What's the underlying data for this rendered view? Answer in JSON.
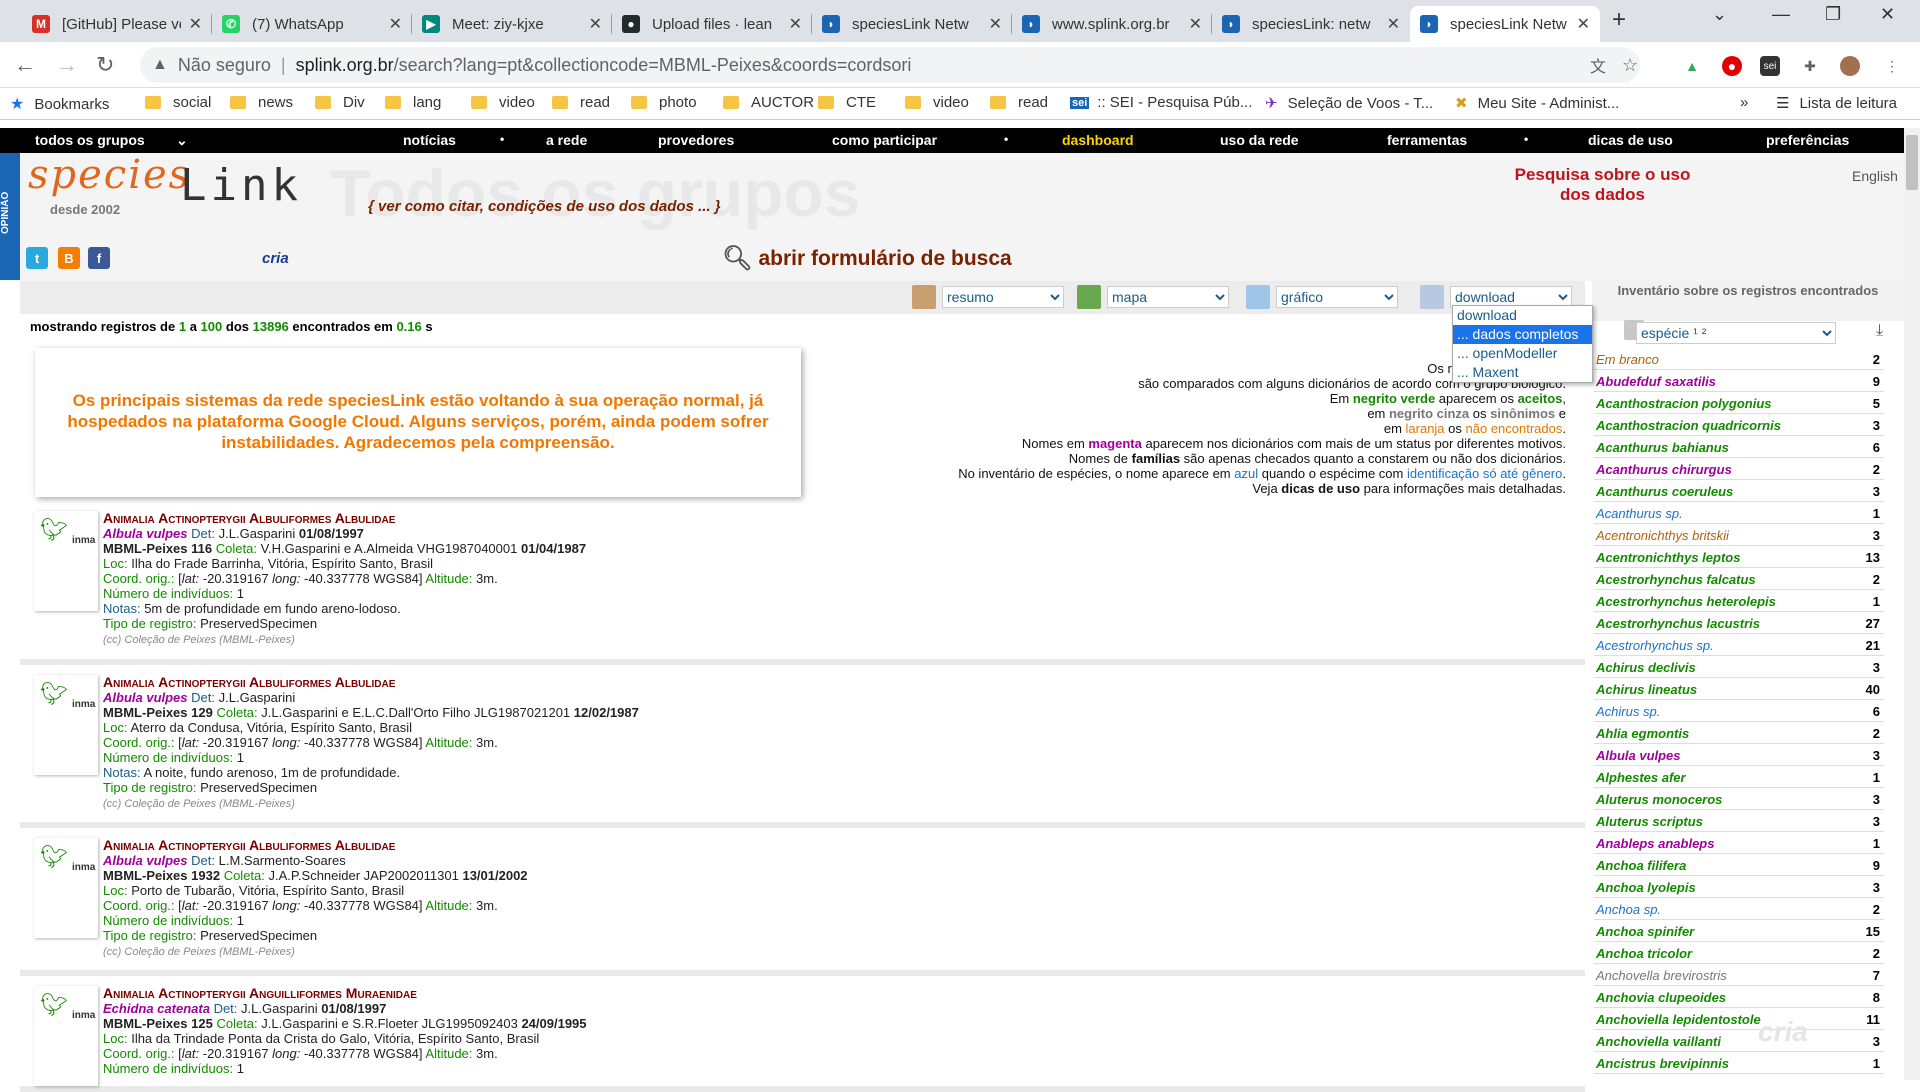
{
  "browser": {
    "tabs": [
      {
        "title": "[GitHub] Please ve",
        "favicon": "gmail-icon",
        "color": "#d93025",
        "glyph": "M"
      },
      {
        "title": "(7) WhatsApp",
        "favicon": "whatsapp-icon",
        "color": "#25d366",
        "glyph": "✆"
      },
      {
        "title": "Meet: ziy-kjxe",
        "favicon": "meet-icon",
        "color": "#00897b",
        "glyph": "▶"
      },
      {
        "title": "Upload files · lean",
        "favicon": "github-icon",
        "color": "#24292e",
        "glyph": "●"
      },
      {
        "title": "speciesLink Netw",
        "favicon": "specieslink-icon",
        "color": "#1a66b5",
        "glyph": "◗"
      },
      {
        "title": "www.splink.org.br",
        "favicon": "specieslink-icon",
        "color": "#1a66b5",
        "glyph": "◗"
      },
      {
        "title": "speciesLink: netw",
        "favicon": "specieslink-icon",
        "color": "#1a66b5",
        "glyph": "◗"
      },
      {
        "title": "speciesLink Netw",
        "favicon": "specieslink-icon",
        "color": "#1a66b5",
        "glyph": "◗"
      }
    ],
    "active_tab": 7,
    "new_tab": "+",
    "address": {
      "security": "Não seguro",
      "host": "splink.org.br",
      "path": "/search?lang=pt&collectioncode=MBML-Peixes&coords=cordsori"
    },
    "bookmarks": [
      {
        "label": "Bookmarks",
        "icon": "star-icon"
      },
      {
        "label": "social",
        "icon": "folder-icon"
      },
      {
        "label": "news",
        "icon": "folder-icon"
      },
      {
        "label": "Div",
        "icon": "folder-icon"
      },
      {
        "label": "lang",
        "icon": "folder-icon"
      },
      {
        "label": "video",
        "icon": "folder-icon"
      },
      {
        "label": "read",
        "icon": "folder-icon"
      },
      {
        "label": "photo",
        "icon": "folder-icon"
      },
      {
        "label": "AUCTOR",
        "icon": "folder-icon"
      },
      {
        "label": "CTE",
        "icon": "folder-icon"
      },
      {
        "label": "video",
        "icon": "folder-icon"
      },
      {
        "label": "read",
        "icon": "folder-icon"
      },
      {
        "label": ":: SEI - Pesquisa Púb...",
        "icon": "sei-icon"
      },
      {
        "label": "Seleção de Voos - T...",
        "icon": "flight-icon"
      },
      {
        "label": "Meu Site - Administ...",
        "icon": "site-icon"
      }
    ],
    "bookmarks_more": "»",
    "reading_list": "Lista de leitura"
  },
  "site": {
    "nav": [
      "todos os grupos",
      "notícias",
      "•",
      "a rede",
      "provedores",
      "como participar",
      "•",
      "dashboard",
      "uso da rede",
      "ferramentas",
      "•",
      "dicas de uso",
      "preferências"
    ],
    "opiniao": "OPINIÃO",
    "logo_species": "species",
    "logo_link": "Link",
    "desde": "desde 2002",
    "big_title": "Todos os grupos",
    "cite": "{ ver como citar, condições de uso dos dados ... }",
    "search_link": "abrir formulário de busca",
    "pesquisa": "Pesquisa sobre o uso dos dados",
    "english": "English",
    "cria": "cria",
    "social": [
      {
        "glyph": "t",
        "color": "#2aa9e0"
      },
      {
        "glyph": "B",
        "color": "#f57d00"
      },
      {
        "glyph": "f",
        "color": "#3b5998"
      }
    ]
  },
  "tools": {
    "resumo": "resumo",
    "mapa": "mapa",
    "grafico": "gráfico",
    "download": "download",
    "download_options": [
      "download",
      "... dados completos",
      "... openModeller",
      "... Maxent"
    ],
    "download_selected": 1
  },
  "showing": {
    "prefix": "mostrando registros de",
    "from": "1",
    "a": "a",
    "to": "100",
    "dos": "dos",
    "total": "13896",
    "encontrados": "encontrados em",
    "time": "0.16",
    "unit": "s"
  },
  "notice": "Os principais sistemas da rede speciesLink estão voltando à sua operação normal, já hospedados na plataforma Google Cloud. Alguns serviços, porém, ainda podem sofrer instabilidades. Agradecemos pela compreensão.",
  "legend": [
    {
      "parts": [
        [
          "Os nomes das espécies",
          ""
        ]
      ]
    },
    {
      "parts": [
        [
          "são comparados com alguns dicionários de acordo com o grupo biológico.",
          ""
        ]
      ]
    },
    {
      "parts": [
        [
          "Em ",
          ""
        ],
        [
          "negrito verde",
          "g"
        ],
        [
          " aparecem os ",
          ""
        ],
        [
          "aceitos",
          "g"
        ],
        [
          ",",
          ""
        ]
      ]
    },
    {
      "parts": [
        [
          "em ",
          ""
        ],
        [
          "negrito cinza",
          "c"
        ],
        [
          " os ",
          ""
        ],
        [
          "sinônimos",
          "c"
        ],
        [
          " e",
          ""
        ]
      ]
    },
    {
      "parts": [
        [
          "em ",
          ""
        ],
        [
          "laranja",
          "o"
        ],
        [
          " os ",
          ""
        ],
        [
          "não encontrados",
          "o"
        ],
        [
          ".",
          ""
        ]
      ]
    },
    {
      "parts": [
        [
          "Nomes em ",
          ""
        ],
        [
          "magenta",
          "m"
        ],
        [
          " aparecem nos dicionários com mais de um status por diferentes motivos.",
          ""
        ]
      ]
    },
    {
      "parts": [
        [
          "Nomes de ",
          ""
        ],
        [
          "famílias",
          "bold"
        ],
        [
          " são apenas checados quanto a constarem ou não dos dicionários.",
          ""
        ]
      ]
    },
    {
      "parts": [
        [
          "No inventário de espécies, o nome aparece em ",
          ""
        ],
        [
          "azul",
          "b"
        ],
        [
          " quando o espécime com ",
          ""
        ],
        [
          "identificação só até gênero",
          "b"
        ],
        [
          ".",
          ""
        ]
      ]
    },
    {
      "parts": [
        [
          "Veja ",
          ""
        ],
        [
          "dicas de uso",
          "bold"
        ],
        [
          " para informações mais detalhadas.",
          ""
        ]
      ]
    }
  ],
  "records": [
    {
      "taxonomy": "Animalia Actinopterygii Albuliformes Albulidae",
      "species": "Albula vulpes",
      "det": "J.L.Gasparini",
      "det_date": "01/08/1997",
      "catalog": "MBML-Peixes 116",
      "coleta": "V.H.Gasparini e A.Almeida VHG1987040001",
      "coleta_date": "01/04/1987",
      "loc": "Ilha do Frade Barrinha, Vitória, Espírito Santo, Brasil",
      "lat": "-20.319167",
      "long": "-40.337778 WGS84",
      "alt": "3m.",
      "individuos": "1",
      "notas": "5m de profundidade em fundo areno-lodoso.",
      "tipo": "PreservedSpecimen",
      "cc": "(cc) Coleção de Peixes (MBML-Peixes)"
    },
    {
      "taxonomy": "Animalia Actinopterygii Albuliformes Albulidae",
      "species": "Albula vulpes",
      "det": "J.L.Gasparini",
      "det_date": "",
      "catalog": "MBML-Peixes 129",
      "coleta": "J.L.Gasparini e E.L.C.Dall'Orto Filho JLG1987021201",
      "coleta_date": "12/02/1987",
      "loc": "Aterro da Condusa, Vitória, Espírito Santo, Brasil",
      "lat": "-20.319167",
      "long": "-40.337778 WGS84",
      "alt": "3m.",
      "individuos": "1",
      "notas": "A noite, fundo arenoso, 1m de profundidade.",
      "tipo": "PreservedSpecimen",
      "cc": "(cc) Coleção de Peixes (MBML-Peixes)"
    },
    {
      "taxonomy": "Animalia Actinopterygii Albuliformes Albulidae",
      "species": "Albula vulpes",
      "det": "L.M.Sarmento-Soares",
      "det_date": "",
      "catalog": "MBML-Peixes 1932",
      "coleta": "J.A.P.Schneider JAP2002011301",
      "coleta_date": "13/01/2002",
      "loc": "Porto de Tubarão, Vitória, Espírito Santo, Brasil",
      "lat": "-20.319167",
      "long": "-40.337778 WGS84",
      "alt": "3m.",
      "individuos": "1",
      "notas": "",
      "tipo": "PreservedSpecimen",
      "cc": "(cc) Coleção de Peixes (MBML-Peixes)"
    },
    {
      "taxonomy": "Animalia Actinopterygii Anguilliformes Muraenidae",
      "species": "Echidna catenata",
      "det": "J.L.Gasparini",
      "det_date": "01/08/1997",
      "catalog": "MBML-Peixes 125",
      "coleta": "J.L.Gasparini e S.R.Floeter JLG1995092403",
      "coleta_date": "24/09/1995",
      "loc": "Ilha da Trindade Ponta da Crista do Galo, Vitória, Espírito Santo, Brasil",
      "lat": "-20.319167",
      "long": "-40.337778 WGS84",
      "alt": "3m.",
      "individuos": "1",
      "notas": "",
      "tipo": "",
      "cc": ""
    }
  ],
  "record_labels": {
    "det": "Det:",
    "coleta": "Coleta:",
    "loc": "Loc:",
    "coord": "Coord. orig.:",
    "lat": "lat:",
    "long": "long:",
    "alt": "Altitude:",
    "individuos": "Número de indivíduos:",
    "notas": "Notas:",
    "tipo": "Tipo de registro:"
  },
  "inventory": {
    "title": "Inventário sobre os registros encontrados",
    "select": "espécie ¹ ²",
    "items": [
      {
        "name": "Em branco",
        "count": "2",
        "style": "orange"
      },
      {
        "name": "Abudefduf saxatilis",
        "count": "9",
        "style": "magenta"
      },
      {
        "name": "Acanthostracion polygonius",
        "count": "5",
        "style": "green"
      },
      {
        "name": "Acanthostracion quadricornis",
        "count": "3",
        "style": "green"
      },
      {
        "name": "Acanthurus bahianus",
        "count": "6",
        "style": "green"
      },
      {
        "name": "Acanthurus chirurgus",
        "count": "2",
        "style": "magenta"
      },
      {
        "name": "Acanthurus coeruleus",
        "count": "3",
        "style": "green"
      },
      {
        "name": "Acanthurus sp.",
        "count": "1",
        "style": "blue"
      },
      {
        "name": "Acentronichthys britskii",
        "count": "3",
        "style": "orange"
      },
      {
        "name": "Acentronichthys leptos",
        "count": "13",
        "style": "green"
      },
      {
        "name": "Acestrorhynchus falcatus",
        "count": "2",
        "style": "green"
      },
      {
        "name": "Acestrorhynchus heterolepis",
        "count": "1",
        "style": "green"
      },
      {
        "name": "Acestrorhynchus lacustris",
        "count": "27",
        "style": "green"
      },
      {
        "name": "Acestrorhynchus sp.",
        "count": "21",
        "style": "blue"
      },
      {
        "name": "Achirus declivis",
        "count": "3",
        "style": "green"
      },
      {
        "name": "Achirus lineatus",
        "count": "40",
        "style": "green"
      },
      {
        "name": "Achirus sp.",
        "count": "6",
        "style": "blue"
      },
      {
        "name": "Ahlia egmontis",
        "count": "2",
        "style": "green"
      },
      {
        "name": "Albula vulpes",
        "count": "3",
        "style": "magenta"
      },
      {
        "name": "Alphestes afer",
        "count": "1",
        "style": "green"
      },
      {
        "name": "Aluterus monoceros",
        "count": "3",
        "style": "green"
      },
      {
        "name": "Aluterus scriptus",
        "count": "3",
        "style": "green"
      },
      {
        "name": "Anableps anableps",
        "count": "1",
        "style": "magenta"
      },
      {
        "name": "Anchoa filifera",
        "count": "9",
        "style": "green"
      },
      {
        "name": "Anchoa lyolepis",
        "count": "3",
        "style": "green"
      },
      {
        "name": "Anchoa sp.",
        "count": "2",
        "style": "blue"
      },
      {
        "name": "Anchoa spinifer",
        "count": "15",
        "style": "green"
      },
      {
        "name": "Anchoa tricolor",
        "count": "2",
        "style": "green"
      },
      {
        "name": "Anchovella brevirostris",
        "count": "7",
        "style": "gray"
      },
      {
        "name": "Anchovia clupeoides",
        "count": "8",
        "style": "green"
      },
      {
        "name": "Anchoviella lepidentostole",
        "count": "11",
        "style": "green"
      },
      {
        "name": "Anchoviella vaillanti",
        "count": "3",
        "style": "green"
      },
      {
        "name": "Ancistrus brevipinnis",
        "count": "1",
        "style": "green"
      }
    ]
  }
}
